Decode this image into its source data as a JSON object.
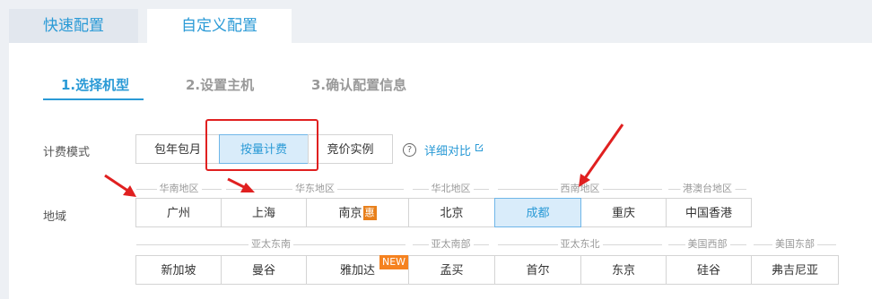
{
  "tabs": [
    {
      "label": "快速配置"
    },
    {
      "label": "自定义配置"
    }
  ],
  "steps": [
    {
      "label": "1.选择机型"
    },
    {
      "label": "2.设置主机"
    },
    {
      "label": "3.确认配置信息"
    }
  ],
  "billing": {
    "label": "计费模式",
    "options": [
      "包年包月",
      "按量计费",
      "竞价实例"
    ],
    "selected": "按量计费",
    "help_icon": "?",
    "compare_link": "详细对比"
  },
  "region": {
    "label": "地域",
    "row1_groups": [
      "华南地区",
      "华东地区",
      "华北地区",
      "西南地区",
      "港澳台地区"
    ],
    "row1_cities": [
      "广州",
      "上海",
      "南京",
      "北京",
      "成都",
      "重庆",
      "中国香港"
    ],
    "hui_badge": "惠",
    "selected": "成都",
    "row2_groups": [
      "亚太东南",
      "亚太南部",
      "亚太东北",
      "美国西部",
      "美国东部"
    ],
    "row2_cities": [
      "新加坡",
      "曼谷",
      "雅加达",
      "孟买",
      "首尔",
      "东京",
      "硅谷",
      "弗吉尼亚"
    ],
    "new_badge": "NEW"
  },
  "colors": {
    "accent": "#2a9ad6",
    "selected_bg": "#d9ecfa",
    "highlight_box": "#e02020",
    "badge_orange": "#e8801c"
  }
}
